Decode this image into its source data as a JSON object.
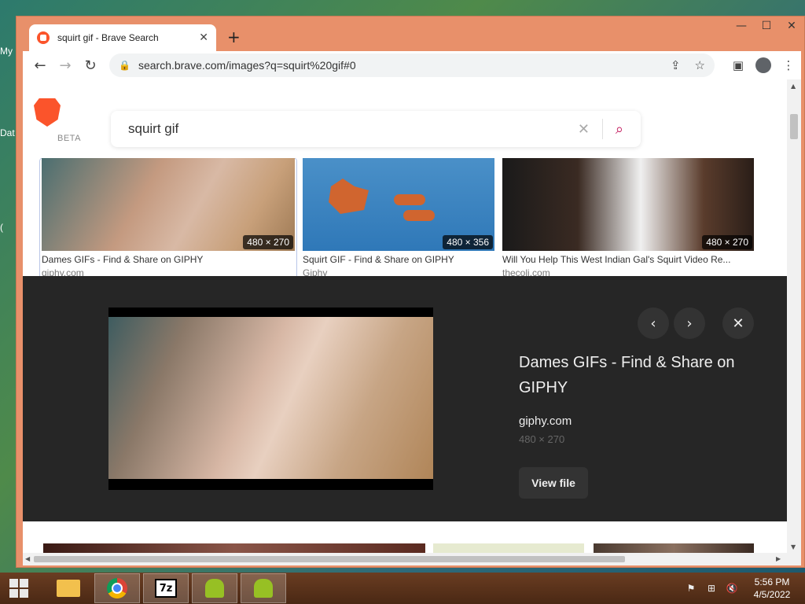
{
  "desktop": {
    "icons": [
      "My",
      "Dat",
      "("
    ]
  },
  "browser": {
    "tab_title": "squirt gif - Brave Search",
    "tab_close": "✕",
    "new_tab": "+",
    "window_controls": {
      "minimize": "—",
      "maximize": "☐",
      "close": "✕"
    },
    "nav": {
      "back": "←",
      "forward": "→",
      "reload": "↻"
    },
    "url": "search.brave.com/images?q=squirt%20gif#0",
    "lock": "🔒",
    "share_icon": "⇪",
    "star_icon": "☆",
    "sidepanel_icon": "▣",
    "menu_icon": "⋮"
  },
  "search": {
    "beta_label": "BETA",
    "query": "squirt gif",
    "clear": "✕",
    "search_icon": "⌕"
  },
  "results": [
    {
      "title": "Dames GIFs - Find & Share on GIPHY",
      "source": "giphy.com",
      "dims": "480 × 270"
    },
    {
      "title": "Squirt GIF - Find & Share on GIPHY",
      "source": "Giphy",
      "dims": "480 × 356"
    },
    {
      "title": "Will You Help This West Indian Gal's Squirt Video Re...",
      "source": "thecoli.com",
      "dims": "480 × 270"
    }
  ],
  "detail": {
    "title": "Dames GIFs - Find & Share on GIPHY",
    "domain": "giphy.com",
    "dims": "480 × 270",
    "view_file": "View file",
    "prev": "‹",
    "next": "›",
    "close": "✕"
  },
  "taskbar": {
    "sevenz_label": "7z",
    "time": "5:56 PM",
    "date": "4/5/2022",
    "tray": {
      "flag": "⚑",
      "network": "⊞",
      "volume": "🔇"
    }
  }
}
